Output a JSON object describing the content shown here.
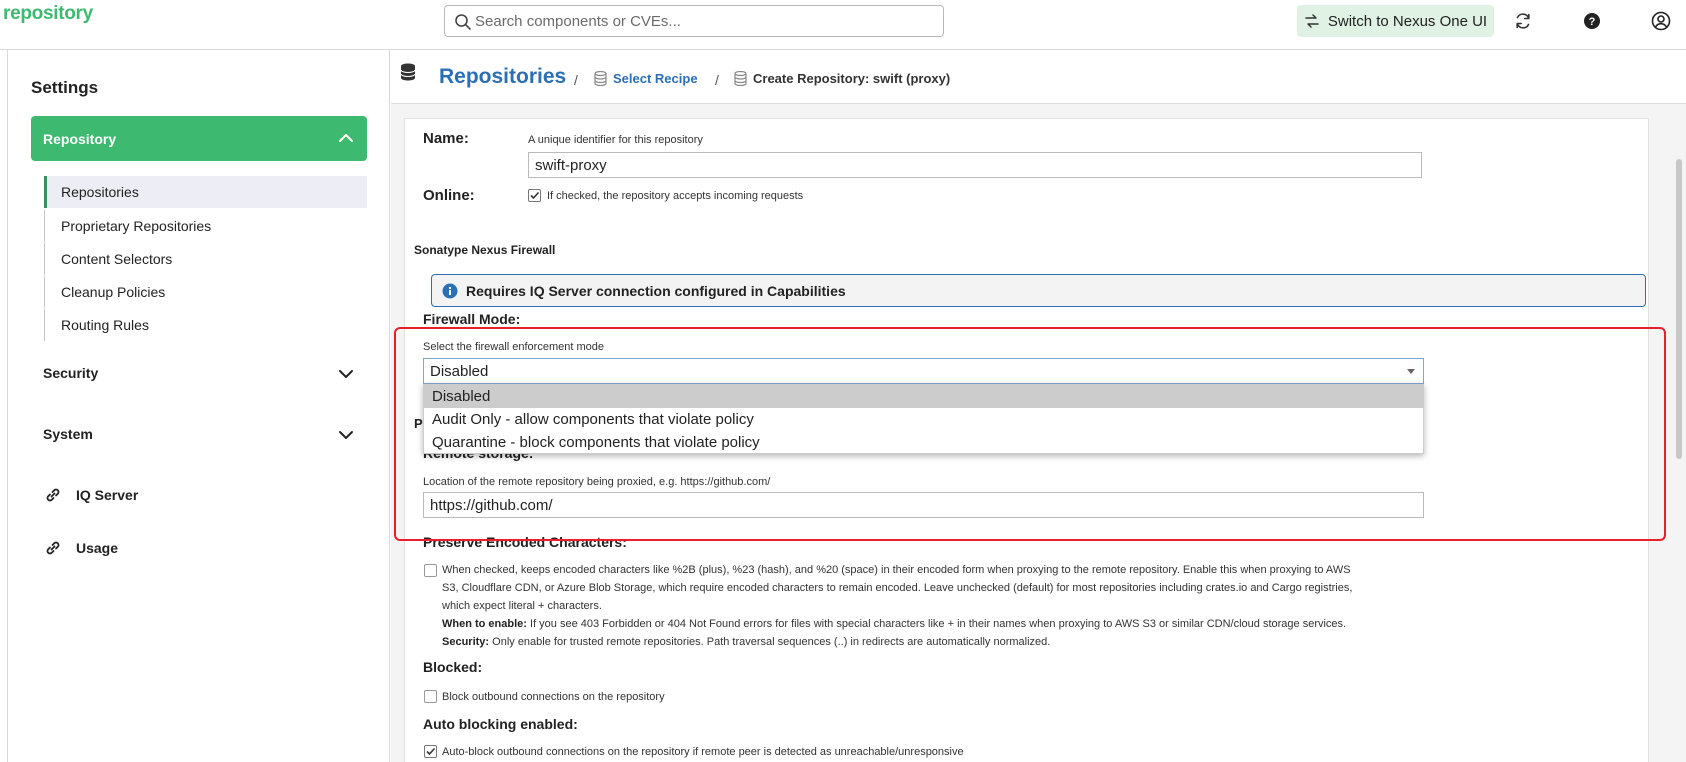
{
  "topbar": {
    "brand": "repository",
    "search_placeholder": "Search components or CVEs...",
    "switch_label": "Switch to Nexus One UI"
  },
  "sidebar": {
    "title": "Settings",
    "group_repository": "Repository",
    "items": [
      "Repositories",
      "Proprietary Repositories",
      "Content Selectors",
      "Cleanup Policies",
      "Routing Rules"
    ],
    "group_security": "Security",
    "group_system": "System",
    "link_iq": "IQ Server",
    "link_usage": "Usage"
  },
  "breadcrumb": {
    "title": "Repositories",
    "sep": "/",
    "select_recipe": "Select Recipe",
    "current": "Create Repository: swift (proxy)"
  },
  "form": {
    "name_label": "Name:",
    "name_help": "A unique identifier for this repository",
    "name_value": "swift-proxy",
    "online_label": "Online:",
    "online_text": "If checked, the repository accepts incoming requests",
    "firewall_section": "Sonatype Nexus Firewall",
    "firewall_info": "Requires IQ Server connection configured in Capabilities",
    "firewall_mode_label": "Firewall Mode:",
    "firewall_mode_help": "Select the firewall enforcement mode",
    "firewall_mode_value": "Disabled",
    "firewall_options": [
      "Disabled",
      "Audit Only - allow components that violate policy",
      "Quarantine - block components that violate policy"
    ],
    "hidden_label_fragment": "P",
    "remote_storage_label": "Remote storage:",
    "remote_storage_help": "Location of the remote repository being proxied, e.g. https://github.com/",
    "remote_storage_value": "https://github.com/",
    "preserve_label": "Preserve Encoded Characters:",
    "preserve_text_1": "When checked, keeps encoded characters like %2B (plus), %23 (hash), and %20 (space) in their encoded form when proxying to the remote repository. Enable this when proxying to AWS",
    "preserve_text_2": "S3, Cloudflare CDN, or Azure Blob Storage, which require encoded characters to remain encoded. Leave unchecked (default) for most repositories including crates.io and Cargo registries,",
    "preserve_text_3": "which expect literal + characters.",
    "when_label": "When to enable:",
    "when_text": "If you see 403 Forbidden or 404 Not Found errors for files with special characters like + in their names when proxying to AWS S3 or similar CDN/cloud storage services.",
    "security_label": "Security:",
    "security_text": "Only enable for trusted remote repositories. Path traversal sequences (..) in redirects are automatically normalized.",
    "blocked_label": "Blocked:",
    "blocked_text": "Block outbound connections on the repository",
    "auto_block_label": "Auto blocking enabled:",
    "auto_block_text": "Auto-block outbound connections on the repository if remote peer is detected as unreachable/unresponsive"
  },
  "colors": {
    "brand_green": "#3dba6f",
    "link_blue": "#2b6fb5",
    "highlight_red": "#e8202a"
  }
}
